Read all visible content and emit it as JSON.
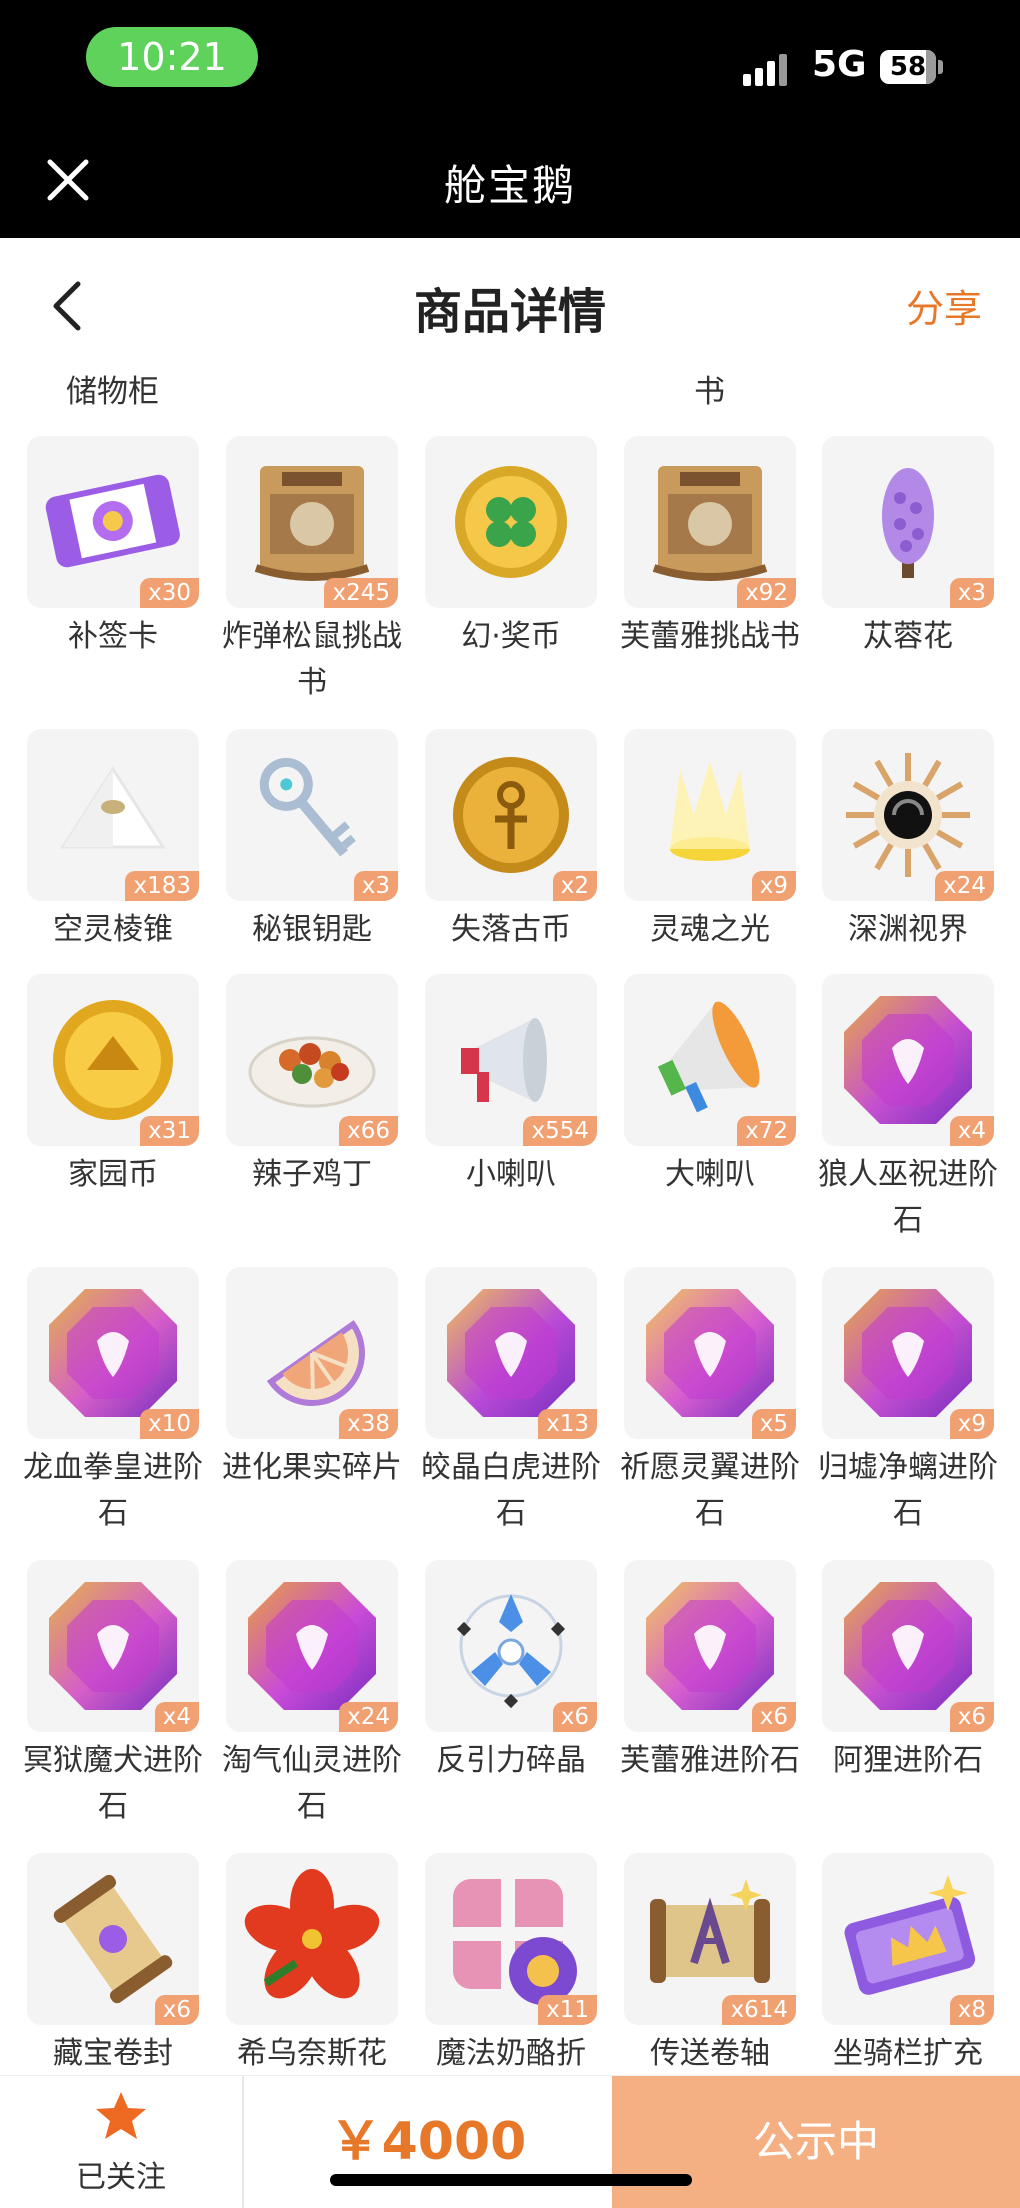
{
  "status": {
    "time": "10:21",
    "network": "5G",
    "battery": "58"
  },
  "app": {
    "title": "舱宝鹅",
    "close_icon": "close-icon"
  },
  "header": {
    "title": "商品详情",
    "share_label": "分享",
    "back_icon": "back-chevron-icon"
  },
  "partial_labels": [
    "储物柜",
    "书"
  ],
  "items": [
    {
      "name": "补签卡",
      "qty": "x30",
      "icon": "makeup-card-icon"
    },
    {
      "name": "炸弹松鼠挑战书",
      "qty": "x245",
      "icon": "wanted-scroll-icon"
    },
    {
      "name": "幻·奖币",
      "qty": "",
      "icon": "clover-coin-icon"
    },
    {
      "name": "芙蕾雅挑战书",
      "qty": "x92",
      "icon": "wanted-scroll-icon"
    },
    {
      "name": "苁蓉花",
      "qty": "x3",
      "icon": "purple-flower-icon"
    },
    {
      "name": "空灵棱锥",
      "qty": "x183",
      "icon": "pyramid-icon"
    },
    {
      "name": "秘银钥匙",
      "qty": "x3",
      "icon": "key-icon"
    },
    {
      "name": "失落古币",
      "qty": "x2",
      "icon": "ankh-coin-icon"
    },
    {
      "name": "灵魂之光",
      "qty": "x9",
      "icon": "soul-light-icon"
    },
    {
      "name": "深渊视界",
      "qty": "x24",
      "icon": "abyss-sun-icon"
    },
    {
      "name": "家园币",
      "qty": "x31",
      "icon": "home-coin-icon"
    },
    {
      "name": "辣子鸡丁",
      "qty": "x66",
      "icon": "food-plate-icon"
    },
    {
      "name": "小喇叭",
      "qty": "x554",
      "icon": "small-megaphone-icon"
    },
    {
      "name": "大喇叭",
      "qty": "x72",
      "icon": "big-megaphone-icon"
    },
    {
      "name": "狼人巫祝进阶石",
      "qty": "x4",
      "icon": "gem-icon"
    },
    {
      "name": "龙血拳皇进阶石",
      "qty": "x10",
      "icon": "gem-icon"
    },
    {
      "name": "进化果实碎片",
      "qty": "x38",
      "icon": "fruit-slice-icon"
    },
    {
      "name": "皎晶白虎进阶石",
      "qty": "x13",
      "icon": "gem-icon"
    },
    {
      "name": "祈愿灵翼进阶石",
      "qty": "x5",
      "icon": "gem-icon"
    },
    {
      "name": "归墟净螭进阶石",
      "qty": "x9",
      "icon": "gem-icon"
    },
    {
      "name": "冥狱魔犬进阶石",
      "qty": "x4",
      "icon": "gem-icon"
    },
    {
      "name": "淘气仙灵进阶石",
      "qty": "x24",
      "icon": "gem-icon"
    },
    {
      "name": "反引力碎晶",
      "qty": "x6",
      "icon": "crystal-shard-icon"
    },
    {
      "name": "芙蕾雅进阶石",
      "qty": "x6",
      "icon": "gem-icon"
    },
    {
      "name": "阿狸进阶石",
      "qty": "x6",
      "icon": "gem-icon"
    },
    {
      "name": "藏宝卷封",
      "qty": "x6",
      "icon": "treasure-scroll-icon"
    },
    {
      "name": "希乌奈斯花",
      "qty": "",
      "icon": "red-flower-icon"
    },
    {
      "name": "魔法奶酪折",
      "qty": "x11",
      "icon": "gift-box-icon"
    },
    {
      "name": "传送卷轴",
      "qty": "x614",
      "icon": "teleport-scroll-icon"
    },
    {
      "name": "坐骑栏扩充",
      "qty": "x8",
      "icon": "mount-ticket-icon"
    }
  ],
  "footer": {
    "follow_label": "已关注",
    "star_icon": "star-icon",
    "price": "￥4000",
    "status_label": "公示中"
  }
}
